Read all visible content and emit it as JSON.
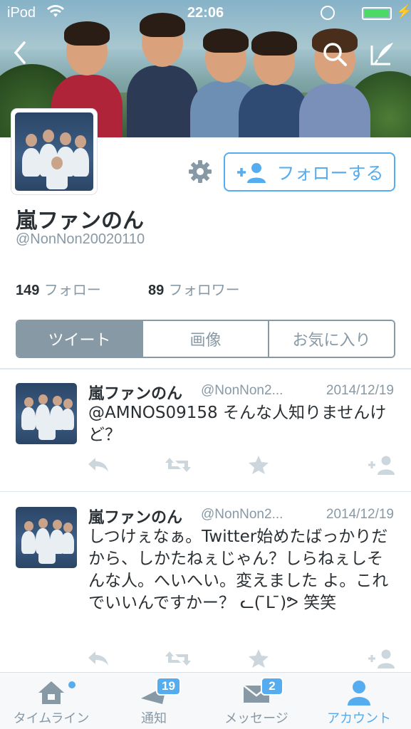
{
  "status_bar": {
    "carrier": "iPod",
    "time": "22:06"
  },
  "profile": {
    "display_name": "嵐ファンのん",
    "handle": "@NonNon20020110",
    "follow_button_label": "フォローする",
    "following_count": "149",
    "following_label": "フォロー",
    "followers_count": "89",
    "followers_label": "フォロワー"
  },
  "tabs": [
    {
      "label": "ツイート",
      "active": true
    },
    {
      "label": "画像",
      "active": false
    },
    {
      "label": "お気に入り",
      "active": false
    }
  ],
  "tweets": [
    {
      "name": "嵐ファンのん",
      "handle": "@NonNon2...",
      "date": "2014/12/19",
      "text": "@AMNOS09158 そんな人知りませんけど？"
    },
    {
      "name": "嵐ファンのん",
      "handle": "@NonNon2...",
      "date": "2014/12/19",
      "text": "しつけぇなぁ。Twitter始めたばっかりだから、しかたねぇじゃん？しらねぇしそんな人。へいへい。変えました よ。これでいいんですかー？ ᓚ( ̄ᒪ ̄)ᕗ 笑笑"
    }
  ],
  "tab_bar": {
    "items": [
      {
        "label": "タイムライン",
        "icon": "home-icon",
        "badge": ""
      },
      {
        "label": "通知",
        "icon": "bell-icon",
        "badge": "19"
      },
      {
        "label": "メッセージ",
        "icon": "envelope-icon",
        "badge": "2"
      },
      {
        "label": "アカウント",
        "icon": "person-icon",
        "badge": ""
      }
    ]
  },
  "colors": {
    "accent": "#55acee",
    "muted": "#8899a6",
    "text": "#292f33",
    "icon_gray": "#ccd6dd"
  }
}
